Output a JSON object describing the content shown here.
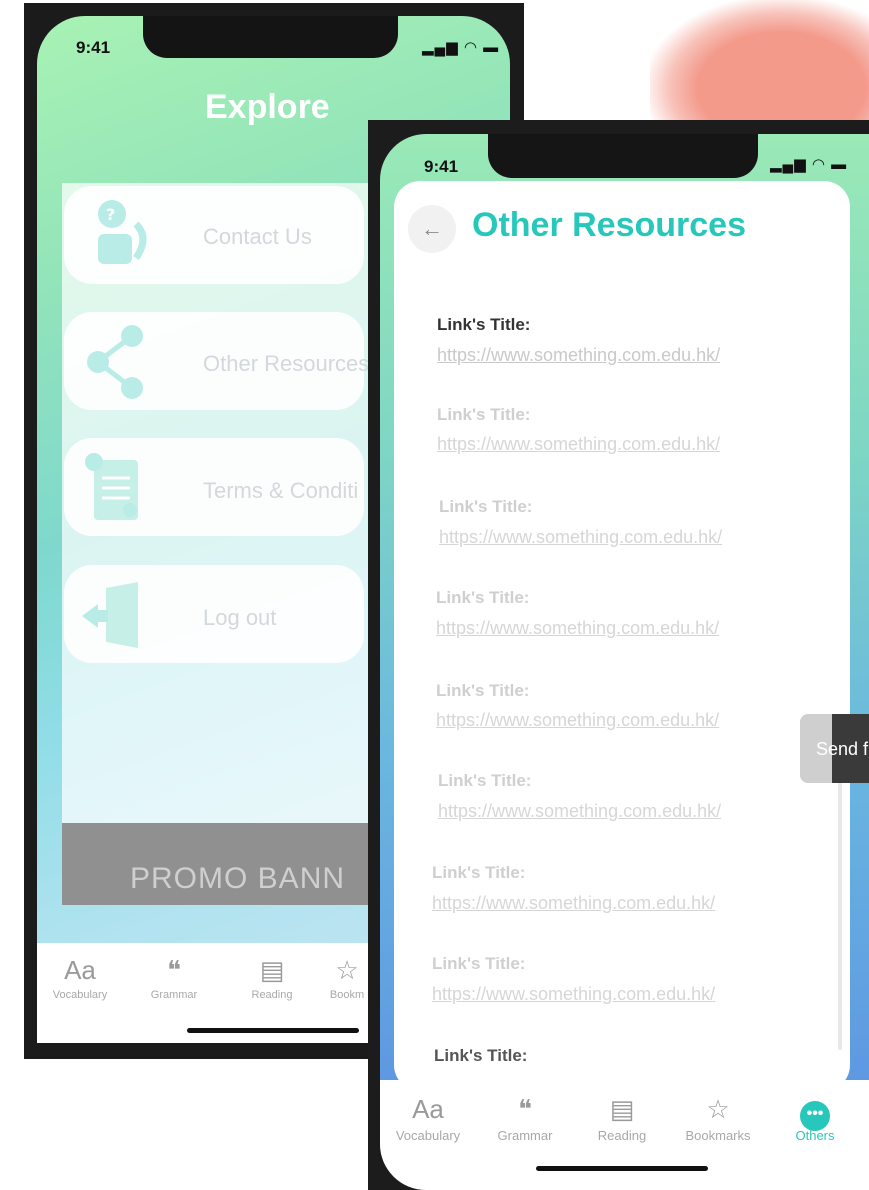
{
  "colors": {
    "accent_teal": "#27c7bc",
    "brush": "#f39a8b",
    "phone_frame": "#1b1b1b"
  },
  "back_phone": {
    "status": {
      "time": "9:41",
      "icons": "▂▄▆ ◠ ▬"
    },
    "title": "Explore",
    "menu": [
      {
        "label": "Contact Us",
        "icon": "contact-support-icon"
      },
      {
        "label": "Other Resources",
        "icon": "share-icon"
      },
      {
        "label": "Terms & Conditi",
        "icon": "document-check-icon"
      },
      {
        "label": "Log out",
        "icon": "logout-door-icon"
      }
    ],
    "promo_banner": "PROMO BANN",
    "tabs": [
      {
        "label": "Vocabulary",
        "glyph": "Aa"
      },
      {
        "label": "Grammar",
        "glyph": "❝"
      },
      {
        "label": "Reading",
        "glyph": "▤"
      },
      {
        "label": "Bookm",
        "glyph": "☆"
      }
    ]
  },
  "front_phone": {
    "status": {
      "time": "9:41",
      "icons": "▂▄▆ ◠ ▬"
    },
    "back_glyph": "←",
    "title": "Other Resources",
    "links": [
      {
        "title": "Link's Title:",
        "url": "https://www.something.com.edu.hk/"
      },
      {
        "title": "Link's Title:",
        "url": "https://www.something.com.edu.hk/"
      },
      {
        "title": "Link's Title:",
        "url": "https://www.something.com.edu.hk/"
      },
      {
        "title": "Link's Title:",
        "url": "https://www.something.com.edu.hk/"
      },
      {
        "title": "Link's Title:",
        "url": "https://www.something.com.edu.hk/"
      },
      {
        "title": "Link's Title:",
        "url": "https://www.something.com.edu.hk/"
      },
      {
        "title": "Link's Title:",
        "url": "https://www.something.com.edu.hk/"
      },
      {
        "title": "Link's Title:",
        "url": "https://www.something.com.edu.hk/"
      },
      {
        "title": "Link's Title:",
        "url": ""
      }
    ],
    "feedback_label": "Send f",
    "tabs": [
      {
        "label": "Vocabulary",
        "glyph": "Aa"
      },
      {
        "label": "Grammar",
        "glyph": "❝"
      },
      {
        "label": "Reading",
        "glyph": "▤"
      },
      {
        "label": "Bookmarks",
        "glyph": "☆"
      },
      {
        "label": "Others",
        "glyph": "•••"
      }
    ],
    "active_tab": "Others"
  }
}
